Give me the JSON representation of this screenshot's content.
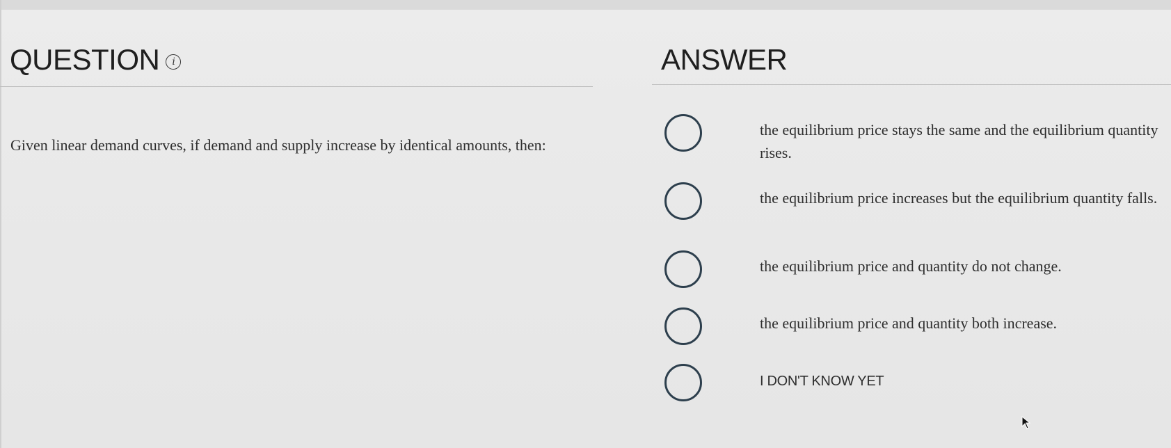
{
  "question": {
    "heading": "QUESTION",
    "info_icon": "info-icon",
    "text": "Given linear demand curves, if demand and supply increase by identical amounts, then:"
  },
  "answer": {
    "heading": "ANSWER",
    "options": [
      {
        "label": "the equilibrium price stays the same and the equilibrium quantity rises."
      },
      {
        "label": "the equilibrium price increases but the equilibrium quantity falls."
      },
      {
        "label": "the equilibrium price and quantity do not change."
      },
      {
        "label": "the equilibrium price and quantity both increase."
      },
      {
        "label": "I DON'T KNOW YET"
      }
    ]
  },
  "colors": {
    "background": "#e9e9e9",
    "radio_border": "#2d3f4d",
    "text": "#2e2e2e"
  }
}
